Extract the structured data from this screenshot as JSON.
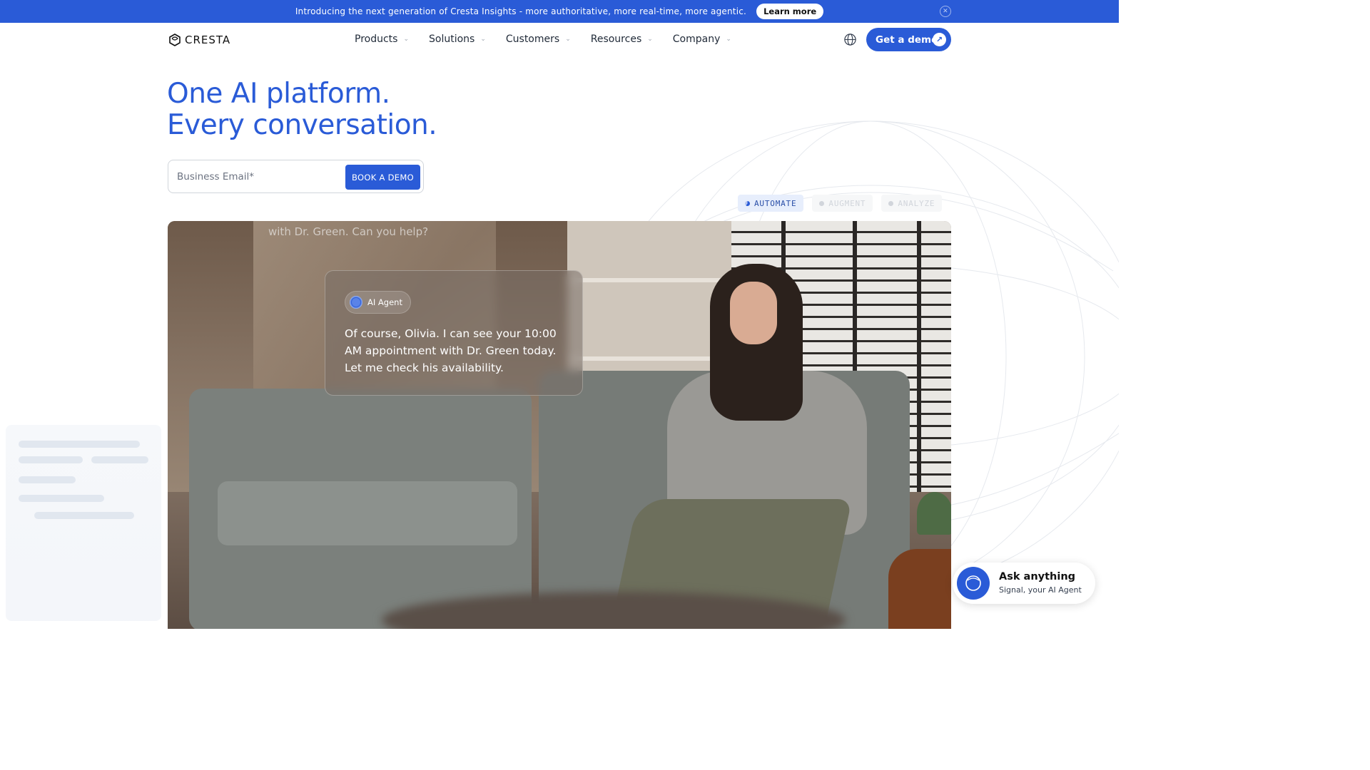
{
  "announcement": {
    "text": "Introducing the next generation of Cresta Insights - more authoritative, more real-time, more agentic.",
    "cta": "Learn more",
    "close_icon": "close-icon"
  },
  "nav": {
    "logo_text": "CRESTA",
    "items": [
      {
        "label": "Products"
      },
      {
        "label": "Solutions"
      },
      {
        "label": "Customers"
      },
      {
        "label": "Resources"
      },
      {
        "label": "Company"
      }
    ],
    "globe_icon": "globe-icon",
    "demo_button": "Get a demo"
  },
  "hero": {
    "title_line1": "One AI platform.",
    "title_line2": "Every conversation.",
    "email_placeholder": "Business Email*",
    "book_button": "BOOK A DEMO"
  },
  "tabs": [
    {
      "label": "AUTOMATE",
      "active": true
    },
    {
      "label": "AUGMENT",
      "active": false
    },
    {
      "label": "ANALYZE",
      "active": false
    }
  ],
  "video": {
    "faded_question": "with Dr. Green. Can you help?",
    "agent_label": "AI Agent",
    "agent_message": "Of course, Olivia. I can see your 10:00 AM appointment with Dr. Green today. Let me check his availability."
  },
  "signal_widget": {
    "title": "Ask anything",
    "subtitle": "Signal, your AI Agent"
  },
  "colors": {
    "brand_blue": "#2a5bd7",
    "tab_active_bg": "#e7eefc"
  }
}
